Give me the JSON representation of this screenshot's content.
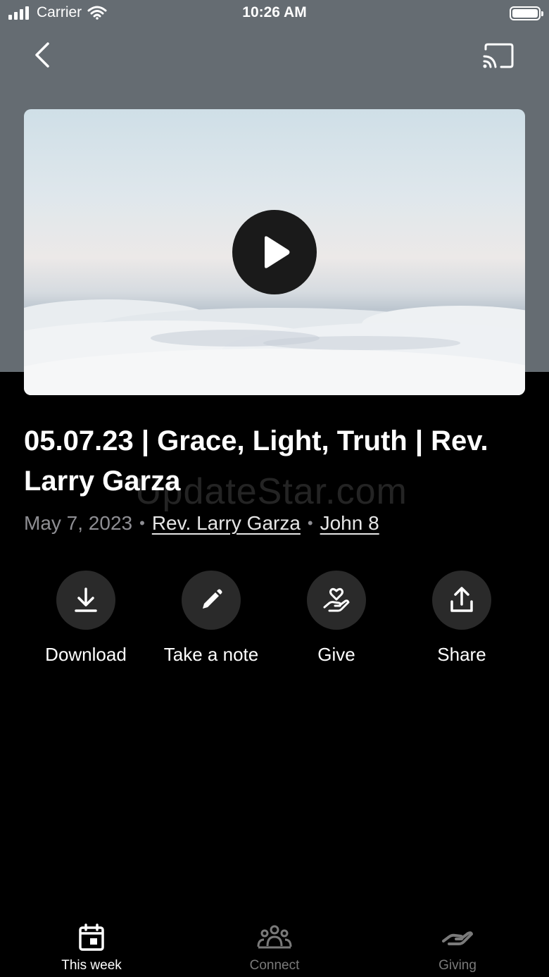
{
  "status_bar": {
    "carrier": "Carrier",
    "time": "10:26 AM"
  },
  "header": {
    "back_icon": "chevron-left-icon",
    "cast_icon": "cast-icon"
  },
  "video": {
    "play_icon": "play-icon"
  },
  "sermon": {
    "title": "05.07.23 | Grace, Light, Truth | Rev. Larry Garza",
    "date": "May 7, 2023",
    "speaker": "Rev. Larry Garza",
    "scripture": "John 8",
    "watermark": "UpdateStar.com"
  },
  "actions": [
    {
      "label": "Download",
      "icon": "download-icon"
    },
    {
      "label": "Take a note",
      "icon": "pencil-icon"
    },
    {
      "label": "Give",
      "icon": "heart-hand-icon"
    },
    {
      "label": "Share",
      "icon": "share-icon"
    }
  ],
  "tabs": [
    {
      "label": "This week",
      "icon": "calendar-icon",
      "active": true
    },
    {
      "label": "Connect",
      "icon": "people-icon",
      "active": false
    },
    {
      "label": "Giving",
      "icon": "giving-hand-icon",
      "active": false
    }
  ],
  "colors": {
    "hero_background": "#656c72",
    "background": "#000000",
    "action_circle": "#2a2a2a",
    "inactive_tab": "#7a7a7a"
  }
}
